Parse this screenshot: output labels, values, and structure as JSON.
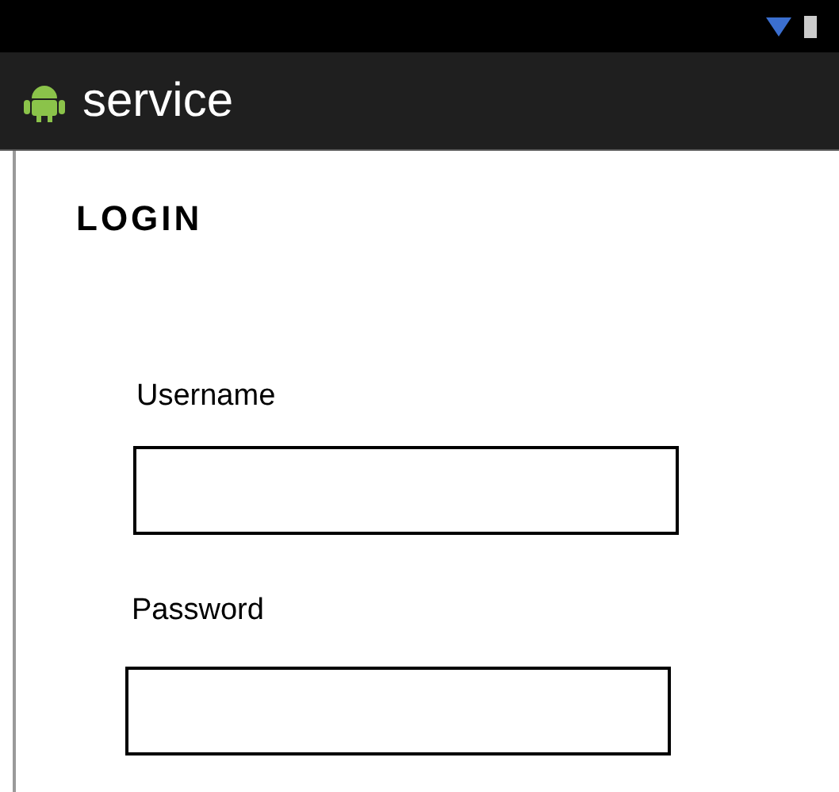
{
  "app_bar": {
    "title": "service"
  },
  "heading": "LOGIN",
  "fields": [
    {
      "label": "Username"
    },
    {
      "label": "Password"
    }
  ]
}
